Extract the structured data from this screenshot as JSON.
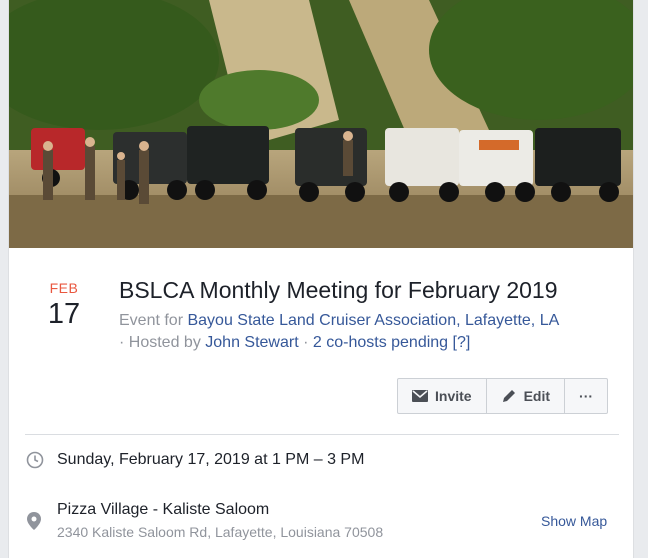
{
  "event": {
    "date": {
      "month": "FEB",
      "day": "17"
    },
    "title": "BSLCA Monthly Meeting for February 2019",
    "event_for_prefix": "Event for ",
    "group_name": "Bayou State Land Cruiser Association, Lafayette, LA",
    "hosted_by_prefix": "· Hosted by ",
    "host_name": "John Stewart",
    "separator": " · ",
    "cohosts_pending": "2 co-hosts pending [?]"
  },
  "actions": {
    "invite_label": "Invite",
    "edit_label": "Edit",
    "more_label": "···"
  },
  "details": {
    "time": "Sunday, February 17, 2019 at 1 PM – 3 PM",
    "location_name": "Pizza Village - Kaliste Saloom",
    "location_address": "2340 Kaliste Saloom Rd, Lafayette, Louisiana 70508",
    "show_map_label": "Show Map"
  },
  "colors": {
    "month_accent": "#e9573f",
    "link": "#365899",
    "secondary_text": "#90949c",
    "primary_text": "#1d2129"
  },
  "icons": {
    "invite": "envelope-icon",
    "edit": "pencil-icon",
    "more": "ellipsis-icon",
    "time": "clock-icon",
    "location": "map-pin-icon"
  }
}
